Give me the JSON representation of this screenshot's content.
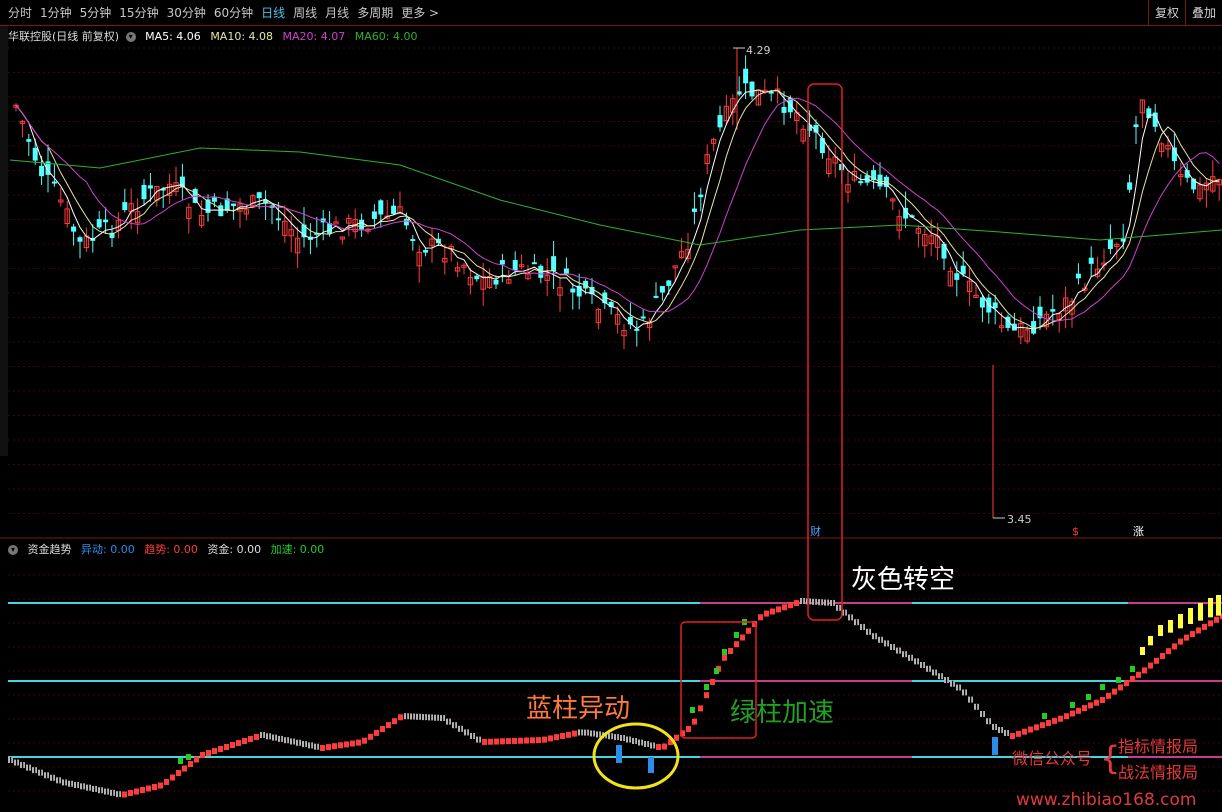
{
  "toolbar": {
    "periods": [
      "分时",
      "1分钟",
      "5分钟",
      "15分钟",
      "30分钟",
      "60分钟",
      "日线",
      "周线",
      "月线",
      "多周期",
      "更多 >"
    ],
    "active_period": "日线",
    "right_buttons": [
      "复权",
      "叠加"
    ]
  },
  "main_legend": {
    "title": "华联控股(日线 前复权)",
    "ma5": "MA5: 4.06",
    "ma10": "MA10: 4.08",
    "ma20": "MA20: 4.07",
    "ma60": "MA60: 4.00"
  },
  "price_marks": {
    "high": "4.29",
    "low": "3.45"
  },
  "event_markers": {
    "fin": "财",
    "rise": "涨",
    "s": "$"
  },
  "indicator_legend": {
    "title": "资金趋势",
    "yidong": "异动: 0.00",
    "qushi": "趋势: 0.00",
    "zijin": "资金: 0.00",
    "jiasu": "加速: 0.00"
  },
  "annotations": {
    "gray_short": "灰色转空",
    "green_accel": "绿柱加速",
    "blue_anomaly": "蓝柱异动"
  },
  "watermark": {
    "wechat": "微信公众号",
    "brace": "{",
    "name1": "指标情报局",
    "name2": "战法情报局",
    "site": "www.zhibiao168.com"
  },
  "colors": {
    "up": "#ff3c3c",
    "down": "#54ffff",
    "ma5": "#ffffff",
    "ma10": "#e6e6a0",
    "ma20": "#d040d0",
    "ma60": "#30b030",
    "gray": "#b4b4b4",
    "blue": "#2a8de8",
    "green": "#22cc22",
    "yellow": "#ffff40",
    "cyan_line": "#44d6e0",
    "magenta_line": "#c83c8c",
    "frame": "#e02020",
    "annot_orange": "#ff7a3c",
    "annot_green": "#22a022"
  }
}
